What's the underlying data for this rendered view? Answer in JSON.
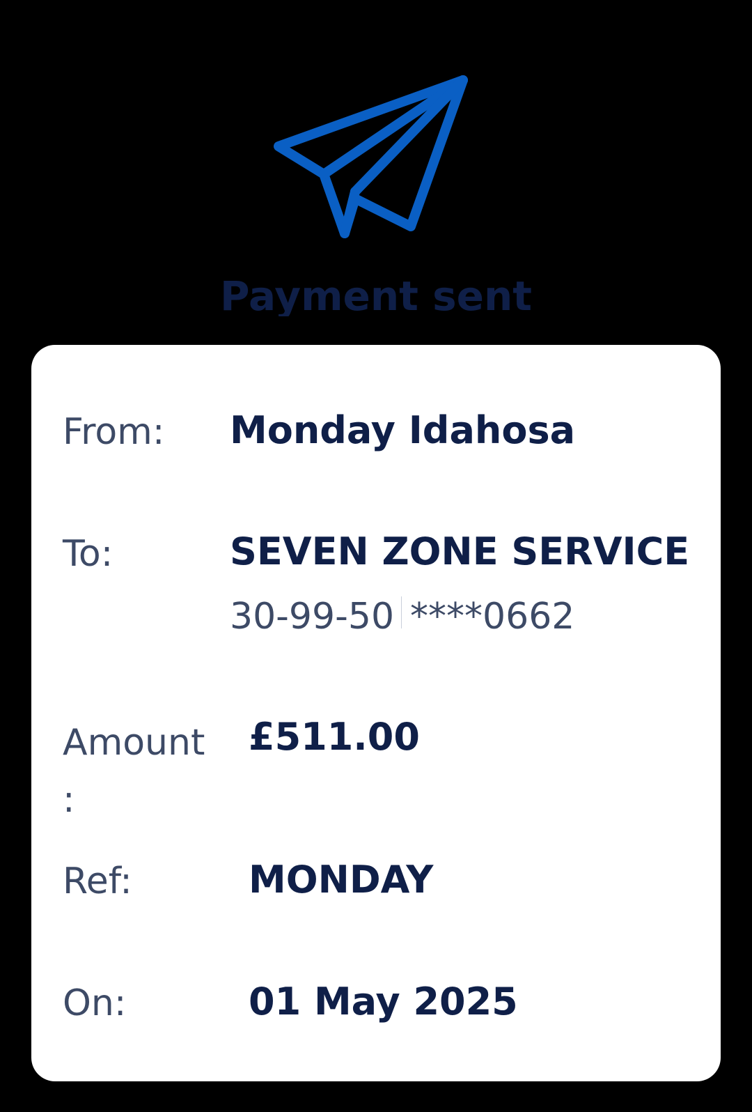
{
  "header": {
    "icon": "paper-plane-icon",
    "icon_color": "#0a5fc4",
    "title": "Payment sent",
    "title_color": "#0f1f48"
  },
  "details": {
    "from_label": "From:",
    "from_value": "Monday Idahosa",
    "to_label": "To:",
    "to_value": "SEVEN ZONE SERVICE",
    "sort_code": "30-99-50",
    "account_masked": "****0662",
    "amount_label": "Amount\n:",
    "amount_value": "£511.00",
    "ref_label": "Ref:",
    "ref_value": "MONDAY",
    "on_label": "On:",
    "on_value": "01 May 2025"
  }
}
